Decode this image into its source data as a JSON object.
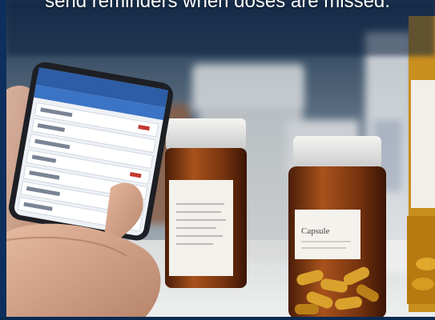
{
  "caption": "send reminders when doses are missed.",
  "phone_screen": {
    "rows": [
      "",
      "",
      "",
      "",
      "",
      "",
      ""
    ]
  },
  "bottle_label_text": "Capsule"
}
